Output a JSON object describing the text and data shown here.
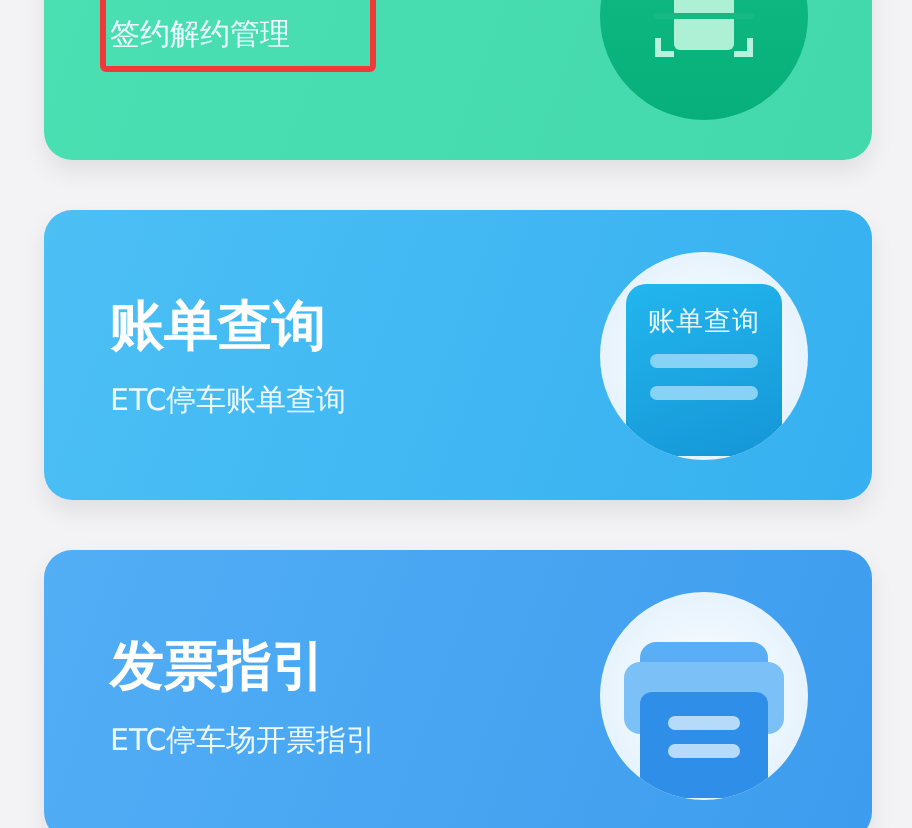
{
  "cards": [
    {
      "kind": "scan",
      "subtitle": "签约解约管理",
      "highlighted": true
    },
    {
      "kind": "bill",
      "title": "账单查询",
      "subtitle": "ETC停车账单查询",
      "icon_text": "账单查询",
      "highlighted": false
    },
    {
      "kind": "printer",
      "title": "发票指引",
      "subtitle": "ETC停车场开票指引",
      "highlighted": false
    }
  ]
}
